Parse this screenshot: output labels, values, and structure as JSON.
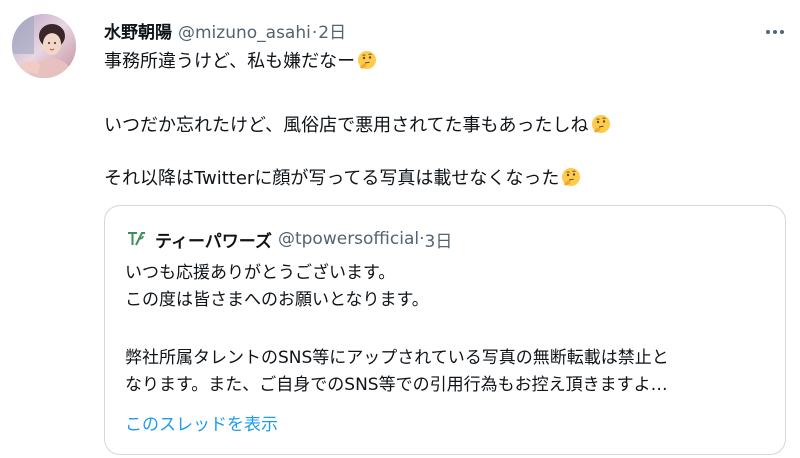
{
  "tweet": {
    "author_name": "水野朝陽",
    "author_handle": "@mizuno_asahi",
    "separator": "·",
    "time": "2日",
    "lines": [
      "事務所違うけど、私も嫌だなー",
      "いつだか忘れたけど、風俗店で悪用されてた事もあったしね",
      "それ以降はTwitterに顔が写ってる写真は載せなくなった"
    ],
    "emoji_icon": "thinking-face-icon",
    "more_icon": "more-dots-icon"
  },
  "quote": {
    "author_name": "ティーパワーズ",
    "author_handle": "@tpowersofficial",
    "separator": "·",
    "time": "3日",
    "lines": [
      "いつも応援ありがとうございます。",
      "この度は皆さまへのお願いとなります。",
      "弊社所属タレントのSNS等にアップされている写真の無断転載は禁止と",
      "なります。また、ご自身でのSNS等での引用行為もお控え頂きますよ…"
    ],
    "show_thread_label": "このスレッドを表示",
    "logo_icon": "tpowers-logo-icon"
  },
  "colors": {
    "text": "#0f1419",
    "secondary": "#536471",
    "link": "#1d9bf0",
    "border": "#cfd9de"
  }
}
